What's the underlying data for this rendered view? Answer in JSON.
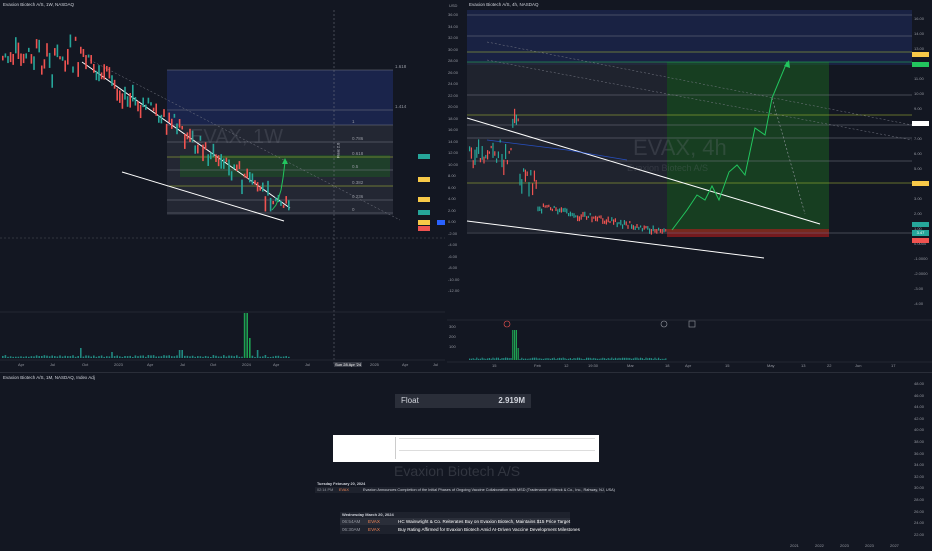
{
  "left_chart": {
    "title": "Evaxion Biotech A/S, 1W, NASDAQ",
    "watermark_ticker": "EVAX, 1W",
    "x_labels": [
      "Apr",
      "Jul",
      "Oct",
      "2023",
      "Apr",
      "Jul",
      "Oct",
      "2024",
      "Apr",
      "Jul",
      "Sun 28 Apr '24",
      "2025",
      "Apr",
      "Jul"
    ],
    "fib_levels": [
      "1.618",
      "1.414",
      "1",
      "0.786",
      "0.618",
      "0.5",
      "0.382",
      "0.236",
      "0"
    ],
    "crosshair_price_label": "Float 2.0"
  },
  "right_chart": {
    "title": "Evaxion Biotech A/S, 4h, NASDAQ",
    "watermark_ticker": "EVAX, 4h",
    "watermark_name": "Evaxion Biotech A/S",
    "x_labels": [
      "15",
      "Feb",
      "12",
      "19:30",
      "Mar",
      "18",
      "Apr",
      "15",
      "May",
      "13",
      "22",
      "Jun",
      "17"
    ],
    "y_labels": [
      "36.00",
      "34.00",
      "32.00",
      "30.00",
      "28.00",
      "26.00",
      "24.00",
      "22.00",
      "20.00",
      "18.00",
      "16.00",
      "14.00",
      "12.00",
      "10.00",
      "8.00",
      "6.00",
      "4.00",
      "2.00",
      "0.00",
      "-2.00",
      "-4.00",
      "-6.00",
      "-8.00",
      "-10.00",
      "-12.00"
    ],
    "currency": "USD",
    "right_scale": [
      "16.00",
      "14.00",
      "13.00",
      "12.00",
      "11.00",
      "10.00",
      "9.00",
      "8.00",
      "7.00",
      "6.00",
      "5.00",
      "4.00",
      "3.00",
      "2.00",
      "1.00",
      "0.0000",
      "-1.0000",
      "-2.0000",
      "-3.00",
      "-4.00"
    ],
    "volume_labels": [
      "300",
      "200",
      "100"
    ],
    "price_tag": "3.47"
  },
  "bottom_chart": {
    "title": "Evaxion Biotech A/S, 1M, NASDAQ, Index Adj",
    "watermark": "Evaxion Biotech A/S",
    "y_labels": [
      "48.00",
      "46.00",
      "44.00",
      "42.00",
      "40.00",
      "38.00",
      "36.00",
      "34.00",
      "32.00",
      "30.00",
      "28.00",
      "26.00",
      "24.00",
      "22.00"
    ],
    "x_labels": [
      "2021",
      "2022",
      "2023",
      "2023",
      "2027"
    ]
  },
  "float_info": {
    "label": "Float",
    "value": "2.919M"
  },
  "news_feed": {
    "date": "Tuesday February 20, 2024",
    "time": "02:14 PM",
    "ticker": "EVAX",
    "headline": "Evaxion Announces Completion of the Initial Phases of Ongoing Vaccine Collaboration with MSD (Tradename of Merck & Co., Inc., Rahway, NJ, USA)"
  },
  "headlines": {
    "date": "Wednesday March 20, 2024",
    "items": [
      {
        "time": "06:54AM",
        "ticker": "EVAX",
        "text": "HC Wainwright & Co. Reiterates Buy on Evaxion Biotech, Maintains $15 Price Target"
      },
      {
        "time": "06:30AM",
        "ticker": "EVAX",
        "text": "Buy Rating Affirmed for Evaxion Biotech Amid AI-Driven Vaccine Development Milestones"
      }
    ]
  },
  "colors": {
    "background": "#131722",
    "green": "#26a69a",
    "red": "#ef5350",
    "bright_green": "#22c55e",
    "blue_zone": "#1e2a5a"
  }
}
